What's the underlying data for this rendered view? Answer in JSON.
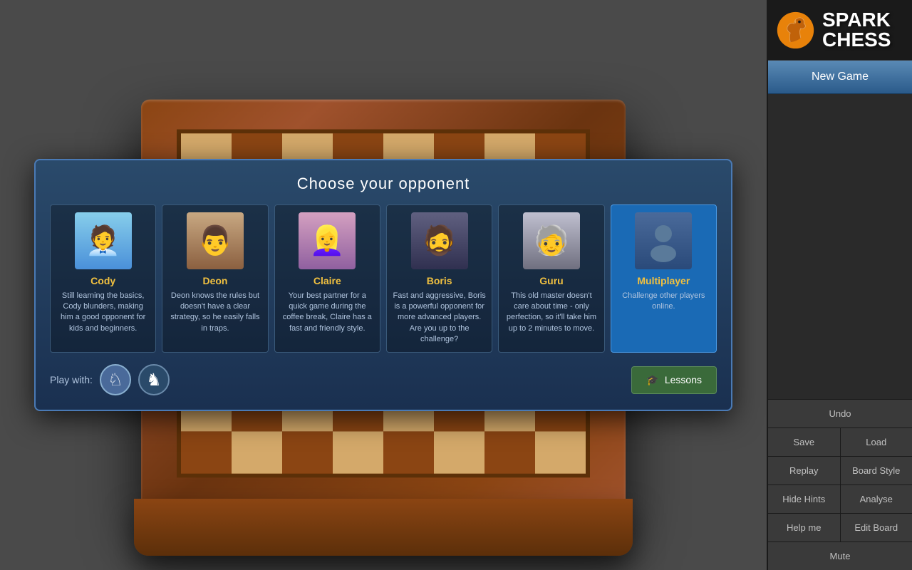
{
  "app": {
    "title_spark": "SPARK",
    "title_chess": "CHESS"
  },
  "sidebar": {
    "new_game": "New Game",
    "undo": "Undo",
    "save": "Save",
    "load": "Load",
    "replay": "Replay",
    "board_style": "Board Style",
    "hide_hints": "Hide Hints",
    "analyse": "Analyse",
    "help_me": "Help me",
    "edit_board": "Edit Board",
    "mute": "Mute"
  },
  "dialog": {
    "title": "Choose your opponent",
    "play_with_label": "Play with:",
    "lessons_label": "Lessons"
  },
  "opponents": [
    {
      "id": "cody",
      "name": "Cody",
      "desc": "Still learning the basics, Cody blunders, making him a good opponent for kids and beginners.",
      "selected": false
    },
    {
      "id": "deon",
      "name": "Deon",
      "desc": "Deon knows the rules but doesn't have a clear strategy, so he easily falls in traps.",
      "selected": false
    },
    {
      "id": "claire",
      "name": "Claire",
      "desc": "Your best partner for a quick game during the coffee break, Claire has a fast and friendly style.",
      "selected": false
    },
    {
      "id": "boris",
      "name": "Boris",
      "desc": "Fast and aggressive, Boris is a powerful opponent for more advanced players. Are you up to the challenge?",
      "selected": false
    },
    {
      "id": "guru",
      "name": "Guru",
      "desc": "This old master doesn't care about time - only perfection, so it'll take him up to 2 minutes to move.",
      "selected": false
    },
    {
      "id": "multiplayer",
      "name": "Multiplayer",
      "desc": "Challenge other players online.",
      "selected": true
    }
  ]
}
